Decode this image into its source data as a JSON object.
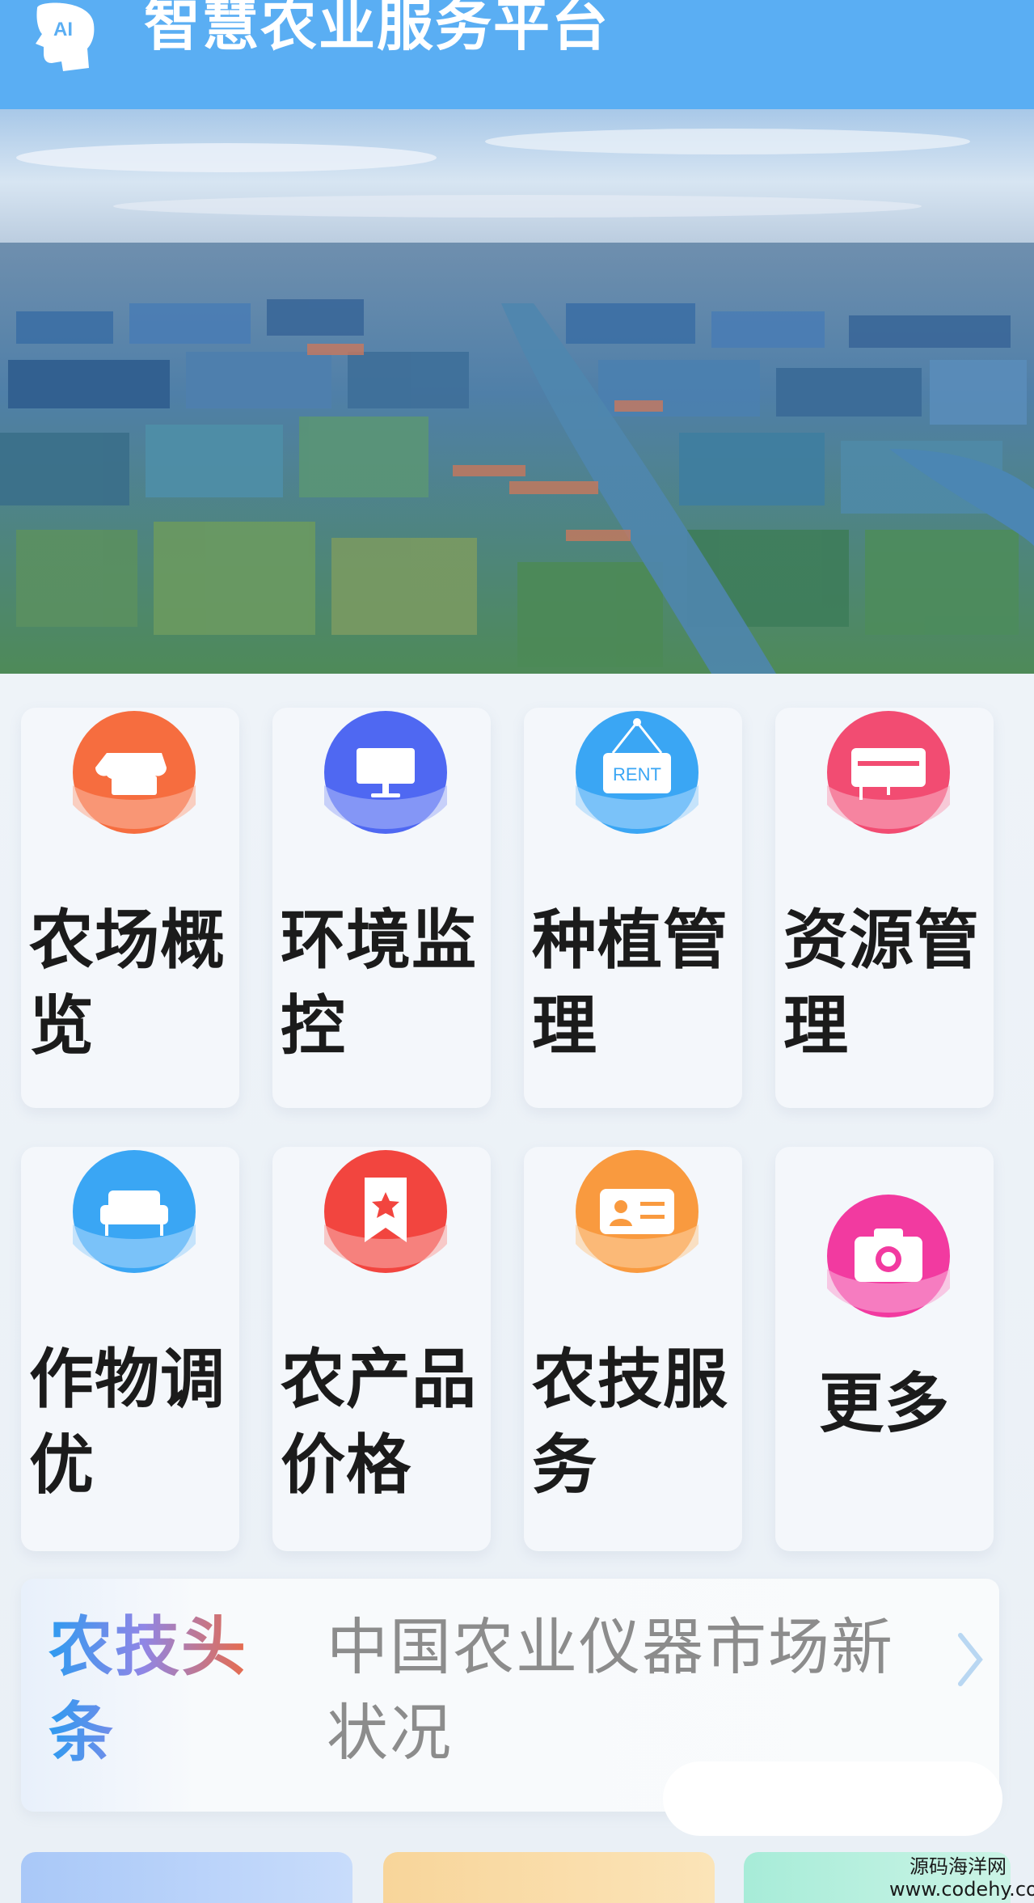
{
  "header": {
    "title": "智慧农业服务平台",
    "logo_text": "AI",
    "background": "#5aaef3"
  },
  "banner": {
    "alt": "aerial farmland"
  },
  "menu": [
    {
      "label": "农场概览",
      "icon": "store-icon",
      "color": "#f66d3f"
    },
    {
      "label": "环境监控",
      "icon": "monitor-icon",
      "color": "#4f68f2"
    },
    {
      "label": "种植管理",
      "icon": "rent-sign-icon",
      "color": "#3aa6f4",
      "icon_text": "RENT"
    },
    {
      "label": "资源管理",
      "icon": "air-conditioner-icon",
      "color": "#f24c72"
    },
    {
      "label": "作物调优",
      "icon": "sofa-icon",
      "color": "#3aa6f4"
    },
    {
      "label": "农产品价格",
      "icon": "bookmark-star-icon",
      "color": "#f2453f"
    },
    {
      "label": "农技服务",
      "icon": "id-card-icon",
      "color": "#f99a3f"
    },
    {
      "label": "更多",
      "icon": "camera-icon",
      "color": "#f23aa0"
    }
  ],
  "news": {
    "tag": "农技头条",
    "headline": "中国农业仪器市场新状况"
  },
  "watermark": {
    "line1": "源码海洋网",
    "line2": "www.codehy.com"
  }
}
